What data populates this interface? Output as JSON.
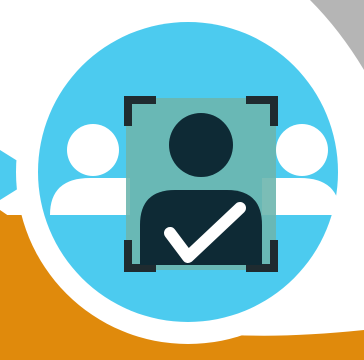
{
  "icon": {
    "name": "face-recognition-verified-icon",
    "colors": {
      "background": "#ffffff",
      "orange_base": "#e08a0c",
      "ring": "#ffffff",
      "circle": "#4ccbef",
      "side_users": "#ffffff",
      "scan_frame_fill": "#6db6ae",
      "scan_frame_corners": "#1f2b30",
      "user_silhouette": "#0e2a35",
      "checkmark": "#ffffff",
      "page_curl_shadow": "#2a2a2a"
    }
  }
}
